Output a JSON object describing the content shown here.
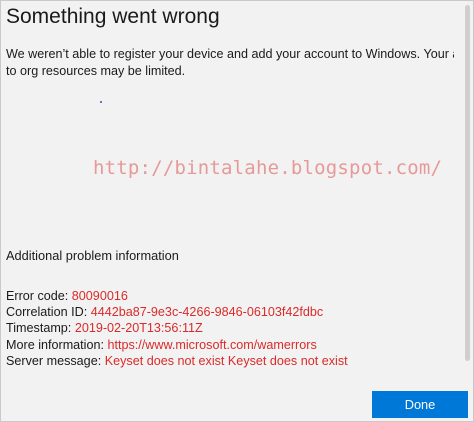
{
  "dialog": {
    "title": "Something went wrong",
    "message_line_1": "We weren’t able to register your device and add your account to Windows. Your acces",
    "message_line_2": "to org resources may be limited.",
    "watermark": "http://bintalahe.blogspot.com/",
    "additional_title": "Additional problem information",
    "details": [
      {
        "label": "Error code:",
        "value": "80090016"
      },
      {
        "label": "Correlation ID:",
        "value": "4442ba87-9e3c-4266-9846-06103f42fdbc"
      },
      {
        "label": "Timestamp:",
        "value": "2019-02-20T13:56:11Z"
      },
      {
        "label": "More information:",
        "value": "https://www.microsoft.com/wamerrors"
      },
      {
        "label": "Server message:",
        "value": "Keyset does not exist Keyset does not exist"
      }
    ],
    "done_label": "Done"
  },
  "colors": {
    "accent": "#0078d7",
    "error_value": "#d92b2b",
    "watermark": "#e48d8d",
    "background": "#f2f2f2"
  }
}
